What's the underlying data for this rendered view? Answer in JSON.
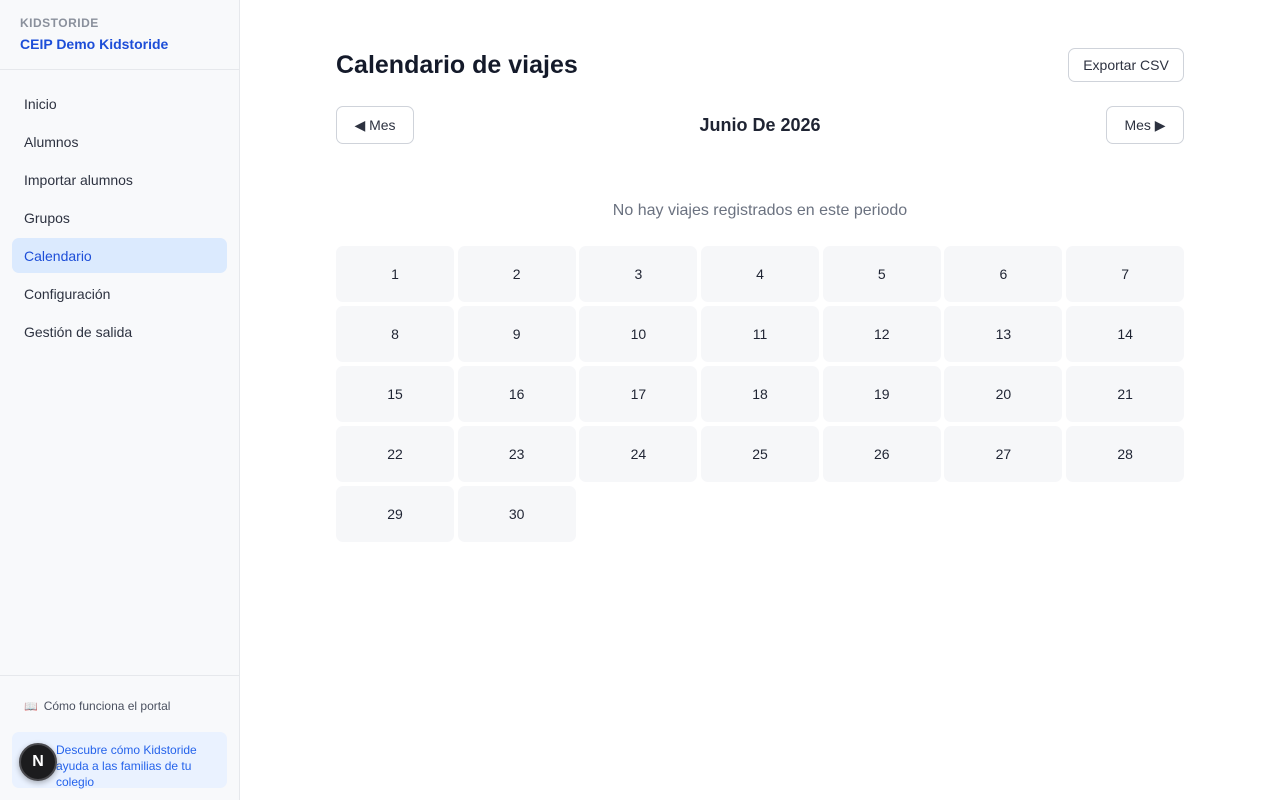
{
  "sidebar": {
    "brand_eyebrow": "KIDSTORIDE",
    "school_name": "CEIP Demo Kidstoride",
    "items": [
      {
        "label": "Inicio"
      },
      {
        "label": "Alumnos"
      },
      {
        "label": "Importar alumnos"
      },
      {
        "label": "Grupos"
      },
      {
        "label": "Calendario",
        "active": true
      },
      {
        "label": "Configuración"
      },
      {
        "label": "Gestión de salida"
      }
    ],
    "help_link": "Cómo funciona el portal",
    "help_icon": "book-icon",
    "promo_text": "Descubre cómo Kidstoride ayuda a las familias de tu colegio",
    "badge_letter": "N"
  },
  "main": {
    "title": "Calendario de viajes",
    "export_label": "Exportar CSV",
    "prev_label": "◀ Mes",
    "next_label": "Mes ▶",
    "month_title": "Junio De 2026",
    "empty_message": "No hay viajes registrados en este periodo",
    "days": [
      "1",
      "2",
      "3",
      "4",
      "5",
      "6",
      "7",
      "8",
      "9",
      "10",
      "11",
      "12",
      "13",
      "14",
      "15",
      "16",
      "17",
      "18",
      "19",
      "20",
      "21",
      "22",
      "23",
      "24",
      "25",
      "26",
      "27",
      "28",
      "29",
      "30"
    ]
  },
  "colors": {
    "accent": "#1d4ed8",
    "active_bg": "#dbeafe",
    "day_bg": "#f6f7f9"
  }
}
